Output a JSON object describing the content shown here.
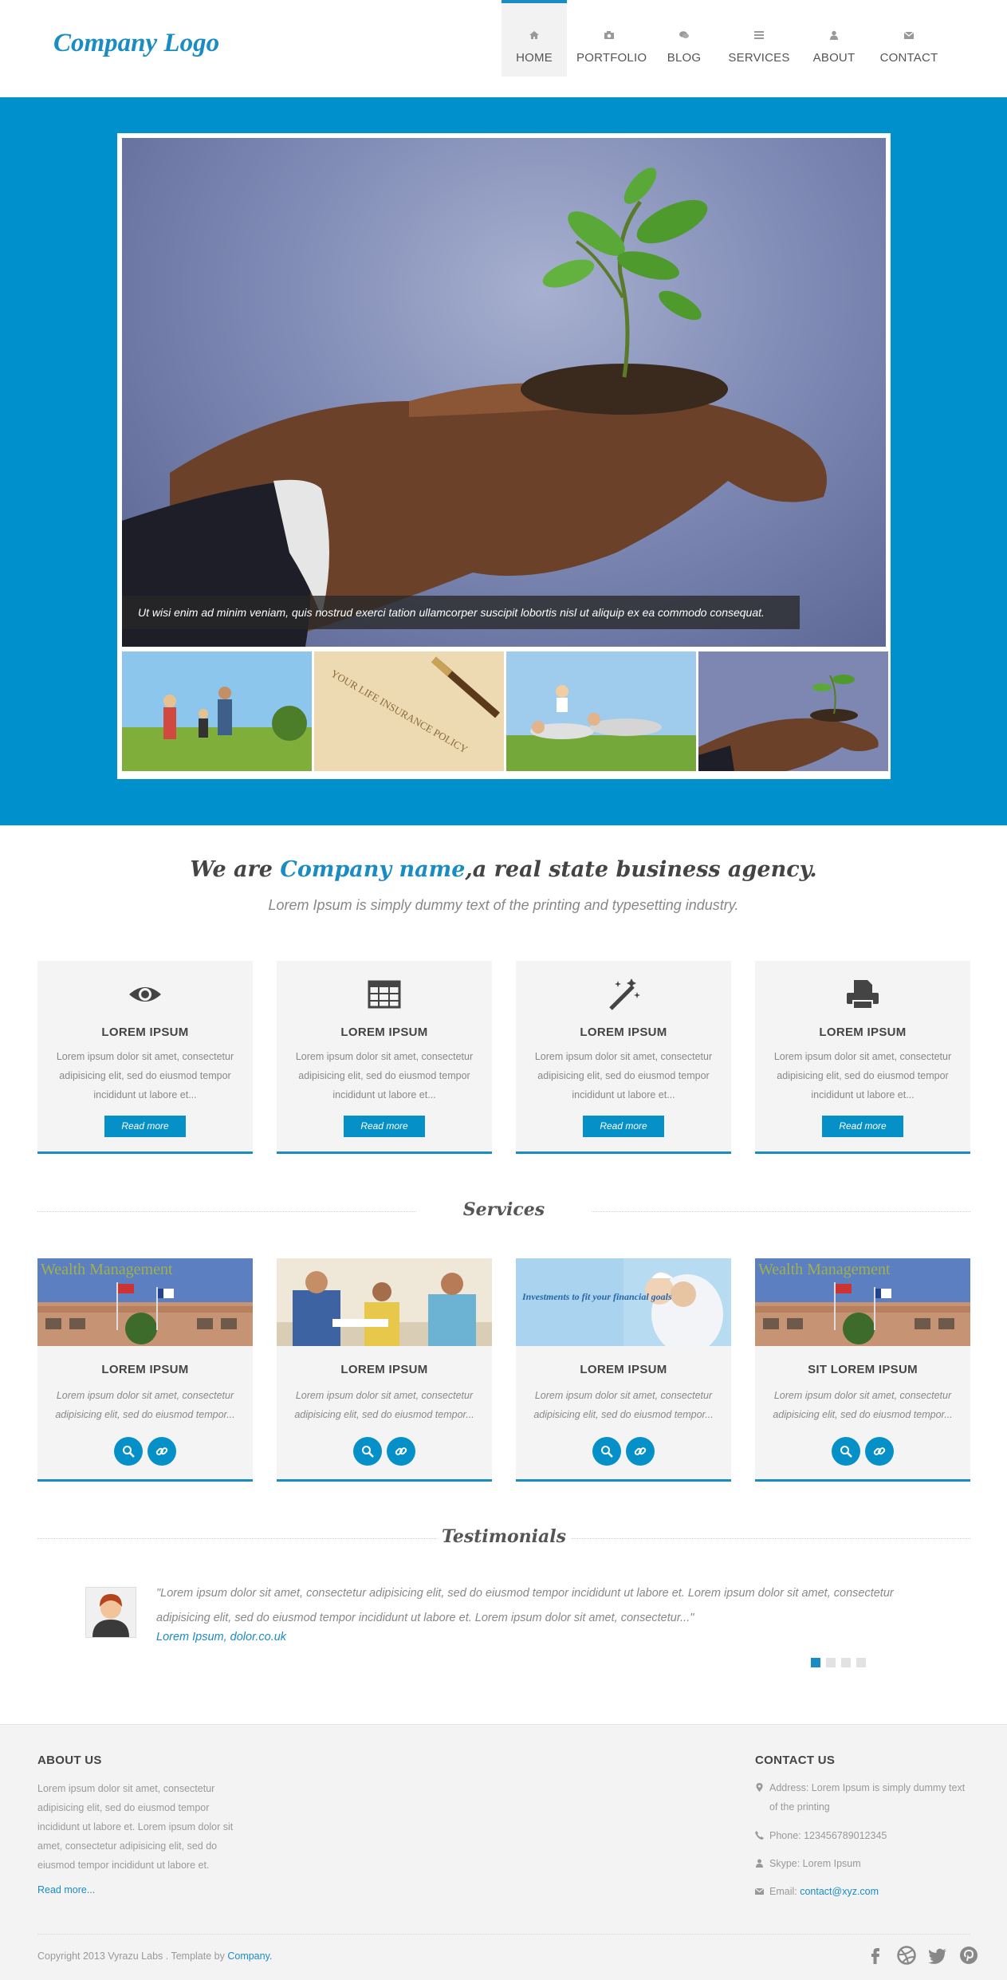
{
  "header": {
    "logo": "Company Logo",
    "nav": [
      {
        "label": "HOME",
        "icon": "home-icon",
        "active": true
      },
      {
        "label": "PORTFOLIO",
        "icon": "camera-icon"
      },
      {
        "label": "BLOG",
        "icon": "comments-icon"
      },
      {
        "label": "SERVICES",
        "icon": "list-icon"
      },
      {
        "label": "ABOUT",
        "icon": "user-icon"
      },
      {
        "label": "CONTACT",
        "icon": "envelope-icon"
      }
    ]
  },
  "slider": {
    "caption": "Ut wisi enim ad minim veniam, quis nostrud exerci tation ullamcorper suscipit lobortis nisl ut aliquip ex ea commodo consequat.",
    "thumb2_text": "YOUR LIFE INSURANCE POLICY"
  },
  "intro": {
    "title_pre": "We are ",
    "title_highlight": "Company name",
    "title_post": ",a real state business agency.",
    "subtitle": "Lorem Ipsum is simply dummy text of the printing and typesetting industry."
  },
  "features": [
    {
      "icon": "eye-icon",
      "title": "LOREM IPSUM",
      "text": "Lorem ipsum dolor sit amet, consectetur adipisicing elit, sed do eiusmod tempor incididunt ut labore et...",
      "button": "Read more"
    },
    {
      "icon": "table-icon",
      "title": "LOREM IPSUM",
      "text": "Lorem ipsum dolor sit amet, consectetur adipisicing elit, sed do eiusmod tempor incididunt ut labore et...",
      "button": "Read more"
    },
    {
      "icon": "magic-wand-icon",
      "title": "LOREM IPSUM",
      "text": "Lorem ipsum dolor sit amet, consectetur adipisicing elit, sed do eiusmod tempor incididunt ut labore et...",
      "button": "Read more"
    },
    {
      "icon": "printer-icon",
      "title": "LOREM IPSUM",
      "text": "Lorem ipsum dolor sit amet, consectetur adipisicing elit, sed do eiusmod tempor incididunt ut labore et...",
      "button": "Read more"
    }
  ],
  "services": {
    "heading": "Services",
    "items": [
      {
        "title": "LOREM IPSUM",
        "text": "Lorem ipsum dolor sit amet, consectetur adipisicing elit, sed do eiusmod tempor...",
        "image_text": "Wealth Management"
      },
      {
        "title": "LOREM IPSUM",
        "text": "Lorem ipsum dolor sit amet, consectetur adipisicing elit, sed do eiusmod tempor...",
        "image_text": ""
      },
      {
        "title": "LOREM IPSUM",
        "text": "Lorem ipsum dolor sit amet, consectetur adipisicing elit, sed do eiusmod tempor...",
        "image_text": "Investments to fit your financial goals"
      },
      {
        "title": "SIT LOREM IPSUM",
        "text": "Lorem ipsum dolor sit amet, consectetur adipisicing elit, sed do eiusmod tempor...",
        "image_text": "Wealth Management"
      }
    ]
  },
  "testimonials": {
    "heading": "Testimonials",
    "quote": "\"Lorem ipsum dolor sit amet, consectetur adipisicing elit, sed do eiusmod tempor incididunt ut labore et. Lorem ipsum dolor sit amet, consectetur adipisicing elit, sed do eiusmod tempor incididunt ut labore et. Lorem ipsum dolor sit amet, consectetur...\"",
    "author": "Lorem Ipsum, dolor.co.uk",
    "active_dot": 1,
    "dot_count": 4
  },
  "footer": {
    "about_heading": "ABOUT US",
    "about_text": "Lorem ipsum dolor sit amet, consectetur adipisicing elit, sed do eiusmod tempor incididunt ut labore et. Lorem ipsum dolor sit amet, consectetur adipisicing elit, sed do eiusmod tempor incididunt ut labore et.",
    "about_link": "Read more...",
    "contact_heading": "CONTACT US",
    "address": "Address: Lorem Ipsum is simply dummy text of the printing",
    "phone": "Phone: 123456789012345",
    "skype": "Skype: Lorem Ipsum",
    "email_label": "Email: ",
    "email": "contact@xyz.com",
    "copyright": "Copyright 2013 Vyrazu Labs . Template by ",
    "copyright_link": "Company.",
    "socials": [
      "facebook-icon",
      "dribbble-icon",
      "twitter-icon",
      "pinterest-icon"
    ]
  },
  "colors": {
    "accent": "#1a8cc4",
    "hero_bg": "#0090cc",
    "card_bg": "#f4f4f4"
  }
}
